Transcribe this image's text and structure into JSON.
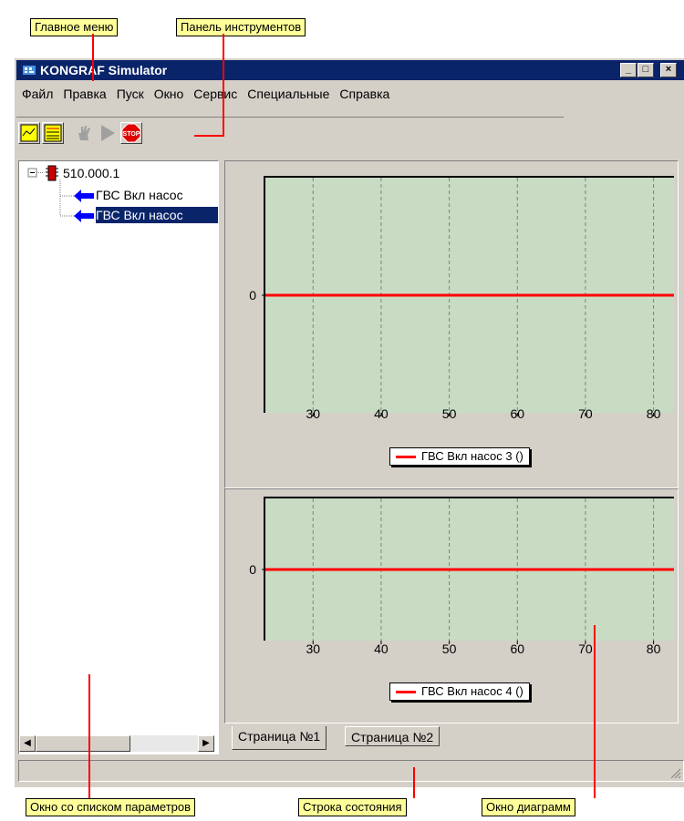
{
  "window": {
    "title": "KONGRAF Simulator",
    "controls": [
      "_",
      "□",
      "×"
    ]
  },
  "menu": [
    "Файл",
    "Правка",
    "Пуск",
    "Окно",
    "Сервис",
    "Специальные",
    "Справка"
  ],
  "toolbar": {
    "buttons": [
      "chart-view",
      "table-view",
      "hand-step",
      "play",
      "stop"
    ],
    "stop_label": "STOP"
  },
  "tree": {
    "root": "510.000.1",
    "items": [
      "ГВС Вкл насос",
      "ГВС Вкл насос"
    ]
  },
  "tabs": [
    "Страница №1",
    "Страница №2"
  ],
  "callouts": {
    "main_menu": "Главное меню",
    "toolbar": "Панель инструментов",
    "param_list": "Окно со списком параметров",
    "status_bar": "Строка состояния",
    "diagram_window": "Окно диаграмм"
  },
  "colors": {
    "plot_bg": "#c8dcc4",
    "series": "#ff0000",
    "title_bg": "#0a246a",
    "callout_bg": "#ffff99"
  },
  "chart_data": [
    {
      "type": "line",
      "x_ticks": [
        30,
        40,
        50,
        60,
        70,
        80
      ],
      "y_ticks": [
        0
      ],
      "xlim": [
        23,
        83
      ],
      "grid": "vertical dashed",
      "series": [
        {
          "name": "ГВС Вкл насос 3 ()",
          "x": [
            23,
            83
          ],
          "y": [
            0,
            0
          ]
        }
      ],
      "legend": "bottom-center"
    },
    {
      "type": "line",
      "x_ticks": [
        30,
        40,
        50,
        60,
        70,
        80
      ],
      "y_ticks": [
        0
      ],
      "xlim": [
        23,
        83
      ],
      "grid": "vertical dashed",
      "series": [
        {
          "name": "ГВС Вкл насос 4 ()",
          "x": [
            23,
            83
          ],
          "y": [
            0,
            0
          ]
        }
      ],
      "legend": "bottom-center"
    }
  ]
}
